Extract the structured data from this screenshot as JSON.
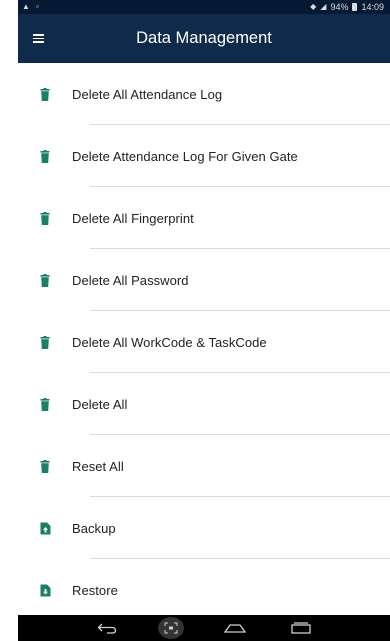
{
  "status_bar": {
    "left_icons": [
      "warning-icon",
      "lock-icon"
    ],
    "battery": "94%",
    "time": "14:09"
  },
  "app_bar": {
    "title": "Data Management",
    "menu_icon": "hamburger-menu-icon"
  },
  "colors": {
    "app_bar": "#0f2a4a",
    "status_bar": "#071a33",
    "accent_icon": "#1a7f66"
  },
  "items": [
    {
      "label": "Delete All Attendance Log",
      "icon": "trash-icon"
    },
    {
      "label": "Delete Attendance Log For Given Gate",
      "icon": "trash-icon"
    },
    {
      "label": "Delete All Fingerprint",
      "icon": "trash-icon"
    },
    {
      "label": "Delete All Password",
      "icon": "trash-icon"
    },
    {
      "label": "Delete All WorkCode & TaskCode",
      "icon": "trash-icon"
    },
    {
      "label": "Delete All",
      "icon": "trash-icon"
    },
    {
      "label": "Reset All",
      "icon": "trash-icon"
    },
    {
      "label": "Backup",
      "icon": "file-upload-icon"
    },
    {
      "label": "Restore",
      "icon": "file-download-icon"
    }
  ],
  "nav_bar": [
    "back-icon",
    "screenshot-icon",
    "home-icon",
    "recents-icon"
  ]
}
